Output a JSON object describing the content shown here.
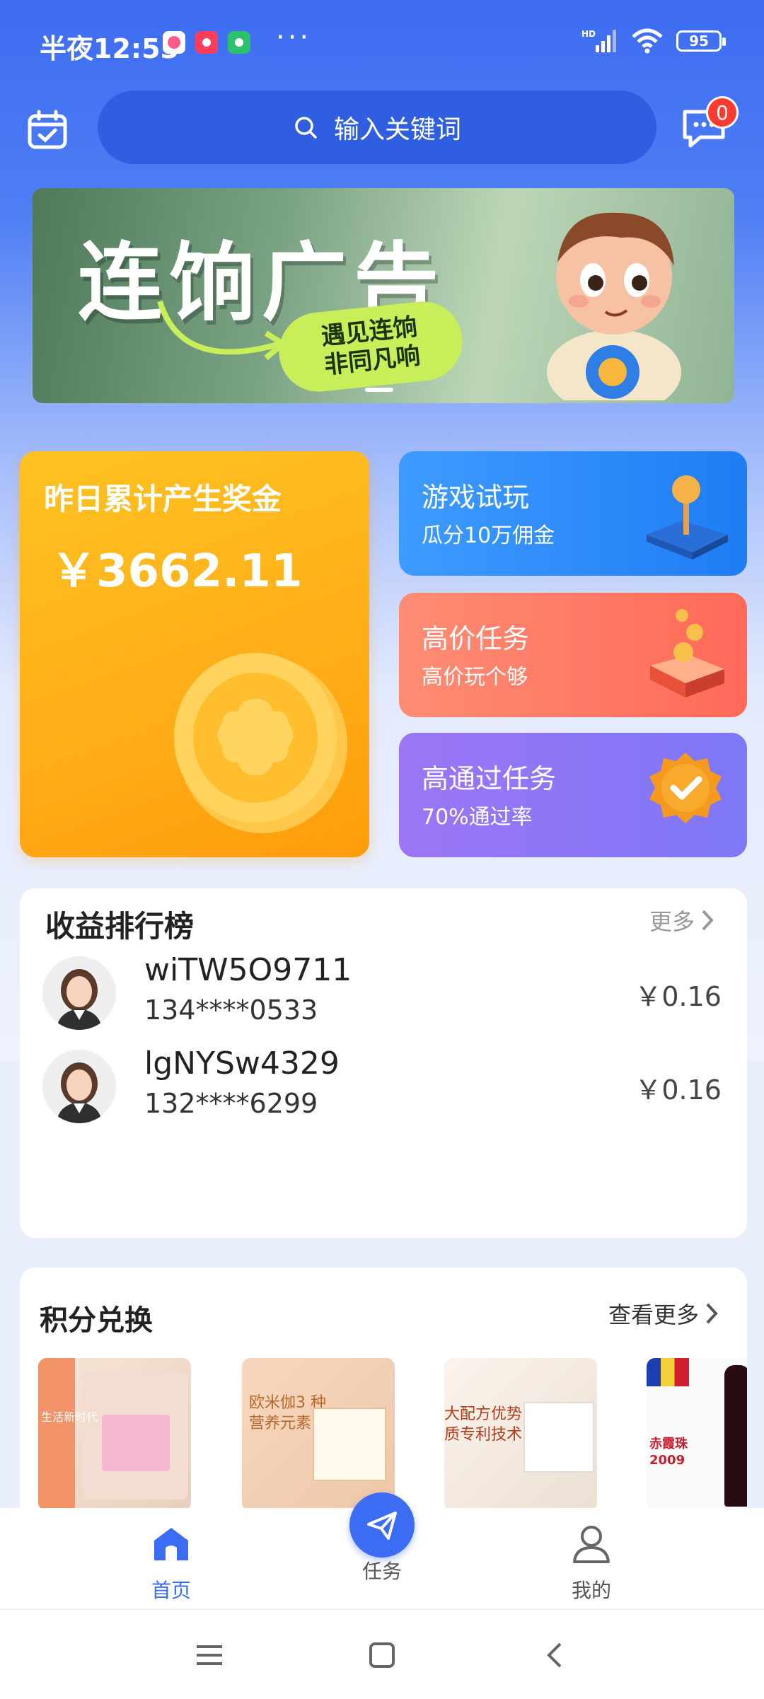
{
  "status_bar": {
    "time": "半夜12:53",
    "more_dots": "···",
    "battery": "95",
    "network": "HD"
  },
  "search": {
    "placeholder": "输入关键词"
  },
  "messages": {
    "badge_count": "0"
  },
  "banner": {
    "title": "连饷广告",
    "slogan_line1": "遇见连饷",
    "slogan_line2": "非同凡响"
  },
  "bonus_card": {
    "label": "昨日累计产生奖金",
    "amount": "￥3662.11"
  },
  "tiles": [
    {
      "title": "游戏试玩",
      "subtitle": "瓜分10万佣金",
      "icon": "joystick-icon"
    },
    {
      "title": "高价任务",
      "subtitle": "高价玩个够",
      "icon": "coin-box-icon"
    },
    {
      "title": "高通过任务",
      "subtitle": "70%通过率",
      "icon": "approved-badge-icon"
    }
  ],
  "ranking": {
    "title": "收益排行榜",
    "more": "更多",
    "rows": [
      {
        "name": "wiTW5O9711",
        "phone": "134****0533",
        "amount": "￥0.16"
      },
      {
        "name": "lgNYSw4329",
        "phone": "132****6299",
        "amount": "￥0.16"
      }
    ]
  },
  "exchange": {
    "title": "积分兑换",
    "more": "查看更多",
    "products": [
      {
        "caption": "生活新时代"
      },
      {
        "caption": "欧米伽3 种营养元素"
      },
      {
        "caption": "大配方优势 质专利技术"
      },
      {
        "caption": "赤霞珠 2009"
      }
    ]
  },
  "tabbar": {
    "home": "首页",
    "task": "任务",
    "mine": "我的"
  },
  "colors": {
    "primary": "#3b6cf3",
    "bonus": "#ffad18",
    "tile_game": "#2a88f8",
    "tile_price": "#ff7560",
    "tile_pass": "#8a77f6"
  }
}
